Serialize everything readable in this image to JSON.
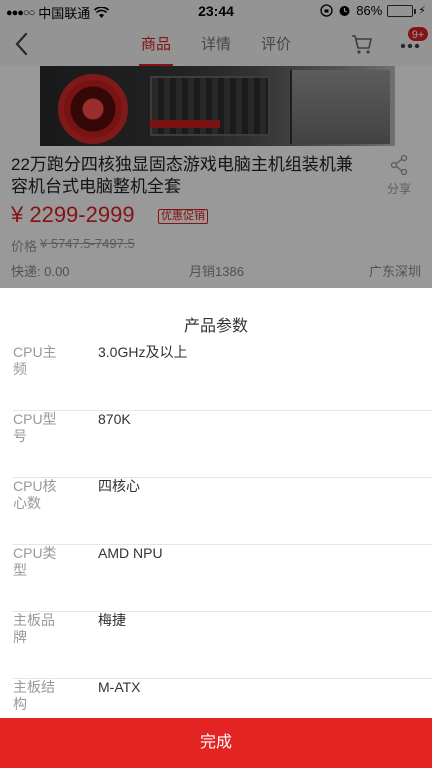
{
  "status_bar": {
    "carrier": "中国联通",
    "time": "23:44",
    "battery_percent": "86%",
    "battery_level": 0.86
  },
  "nav": {
    "tabs": [
      {
        "label": "商品",
        "active": true
      },
      {
        "label": "详情",
        "active": false
      },
      {
        "label": "评价",
        "active": false
      }
    ],
    "badge": "9+"
  },
  "product": {
    "title": "22万跑分四核独显固态游戏电脑主机组装机兼容机台式电脑整机全套",
    "share_label": "分享",
    "price": "¥ 2299-2999",
    "promo_tag": "优惠促销",
    "original_price_label": "价格",
    "original_price": "¥ 5747.5-7497.5",
    "shipping": "快递: 0.00",
    "monthly_sales": "月销1386",
    "location": "广东深圳"
  },
  "sheet": {
    "title": "产品参数",
    "params": [
      {
        "label": "CPU主频",
        "value": "3.0GHz及以上"
      },
      {
        "label": "CPU型号",
        "value": "870K"
      },
      {
        "label": "CPU核心数",
        "value": "四核心"
      },
      {
        "label": "CPU类型",
        "value": "AMD NPU"
      },
      {
        "label": "主板品牌",
        "value": "梅捷"
      },
      {
        "label": "主板结构",
        "value": "M-ATX"
      }
    ],
    "done_label": "完成"
  },
  "colors": {
    "accent": "#e02020",
    "done_button": "#e42323"
  }
}
